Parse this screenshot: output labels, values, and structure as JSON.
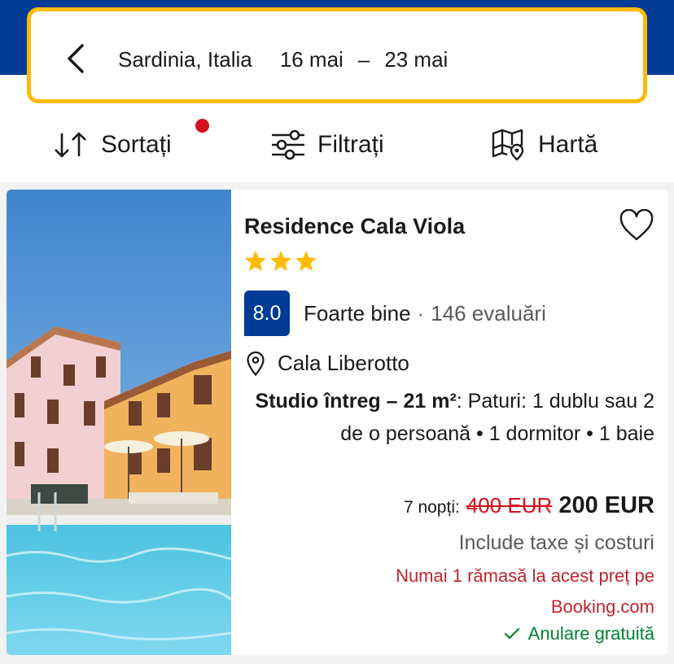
{
  "search": {
    "destination": "Sardinia, Italia",
    "date_from": "16 mai",
    "date_sep": "–",
    "date_to": "23 mai"
  },
  "toolbar": {
    "sort_label": "Sortați",
    "filter_label": "Filtrați",
    "map_label": "Hartă"
  },
  "colors": {
    "brand_blue": "#003b95",
    "accent_yellow": "#febb02",
    "alert_red": "#d4111e",
    "success_green": "#008234"
  },
  "property": {
    "name": "Residence Cala Viola",
    "star_count": 3,
    "score": "8.0",
    "score_label": "Foarte bine",
    "score_separator": "·",
    "review_count": "146 evaluări",
    "location": "Cala Liberotto",
    "room_type": "Studio întreg – 21 m²",
    "room_details": ": Paturi: 1 dublu sau 2 de o persoană • 1 dormitor • 1 baie",
    "nights": "7 nopți:",
    "old_price": "400 EUR",
    "new_price": "200 EUR",
    "taxes_note": "Include taxe și costuri",
    "scarcity_note": "Numai 1 rămasă la acest preț pe Booking.com",
    "free_cancellation": "Anulare gratuită",
    "favorite_icon": "heart-outline-icon",
    "location_icon": "location-pin-icon"
  }
}
